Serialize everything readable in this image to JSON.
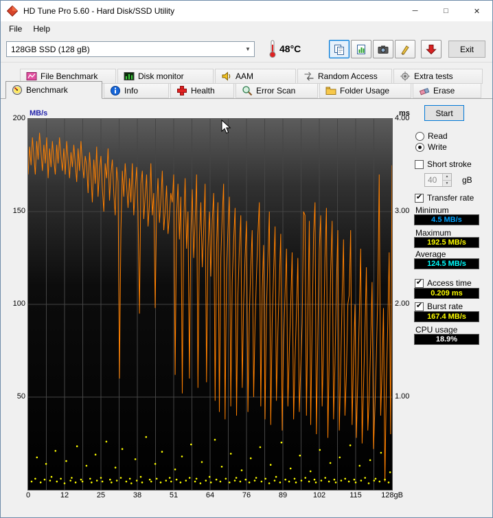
{
  "window": {
    "title": "HD Tune Pro 5.60 - Hard Disk/SSD Utility",
    "minimize_glyph": "─",
    "maximize_glyph": "□",
    "close_glyph": "✕"
  },
  "menu": {
    "file": "File",
    "help": "Help"
  },
  "toolbar": {
    "drive_select_value": "128GB SSD (128 gB)",
    "temperature": "48°C",
    "exit_label": "Exit"
  },
  "tabs": {
    "row1": [
      {
        "label": "File Benchmark"
      },
      {
        "label": "Disk monitor"
      },
      {
        "label": "AAM"
      },
      {
        "label": "Random Access"
      },
      {
        "label": "Extra tests"
      }
    ],
    "row2": [
      {
        "label": "Benchmark",
        "active": true
      },
      {
        "label": "Info"
      },
      {
        "label": "Health"
      },
      {
        "label": "Error Scan"
      },
      {
        "label": "Folder Usage"
      },
      {
        "label": "Erase"
      }
    ]
  },
  "panel": {
    "start_label": "Start",
    "read_label": "Read",
    "write_label": "Write",
    "read_selected": false,
    "write_selected": true,
    "short_stroke_label": "Short stroke",
    "short_stroke_checked": false,
    "short_stroke_value": "40",
    "short_stroke_unit": "gB",
    "transfer_rate_label": "Transfer rate",
    "transfer_rate_checked": true,
    "minimum_label": "Minimum",
    "minimum_value": "4.5 MB/s",
    "maximum_label": "Maximum",
    "maximum_value": "192.5 MB/s",
    "average_label": "Average",
    "average_value": "124.5 MB/s",
    "access_time_label": "Access time",
    "access_time_checked": true,
    "access_time_value": "0.209 ms",
    "burst_rate_label": "Burst rate",
    "burst_rate_checked": true,
    "burst_rate_value": "167.4 MB/s",
    "cpu_usage_label": "CPU usage",
    "cpu_usage_value": "18.9%",
    "value_colors": {
      "minimum": "#00a2ff",
      "maximum": "#ffff00",
      "average": "#00ffff",
      "access_time": "#ffff00",
      "burst_rate": "#ffff00",
      "cpu_usage": "#ffffff"
    }
  },
  "icons": {
    "app-icon": "red diamond",
    "chevron-down-icon": "▼",
    "thermometer-icon": "red thermometer",
    "copy-icon": "two pages",
    "report-icon": "pages with chart",
    "camera-icon": "camera",
    "brush-icon": "yellow brush",
    "download-icon": "red down arrow",
    "spinner-up": "▲",
    "spinner-down": "▼"
  },
  "chart_data": {
    "type": "line+scatter",
    "title": "HD Tune Pro write benchmark: transfer rate (MB/s) line and access time (ms) scatter vs disk position (gB)",
    "x_axis": {
      "min": 0,
      "max": 128,
      "ticks": [
        "0",
        "12",
        "25",
        "38",
        "51",
        "64",
        "76",
        "89",
        "102",
        "115",
        "128gB"
      ]
    },
    "y_left": {
      "label": "MB/s",
      "min": 0,
      "max": 200,
      "ticks": [
        {
          "label": "200",
          "value": 200
        },
        {
          "label": "150",
          "value": 150
        },
        {
          "label": "100",
          "value": 100
        },
        {
          "label": "50",
          "value": 50
        }
      ]
    },
    "y_right": {
      "label": "ms",
      "min": 0,
      "max": 4,
      "ticks": [
        {
          "label": "4.00",
          "value": 4
        },
        {
          "label": "3.00",
          "value": 3
        },
        {
          "label": "2.00",
          "value": 2
        },
        {
          "label": "1.00",
          "value": 1
        }
      ]
    },
    "grid": {
      "v_divisions": 20,
      "h_values": [
        50,
        100,
        150
      ]
    },
    "colors": {
      "transfer_rate": "#ff8000",
      "access_time": "#ffff00",
      "grid": "#454545",
      "plot_top": "#5c5c5c",
      "plot_bottom": "#000000"
    },
    "legend": "none",
    "transfer_rate_mbps": {
      "units": "MB/s",
      "values": [
        170,
        185,
        175,
        190,
        180,
        170,
        188,
        178,
        192.5,
        182,
        172,
        186,
        176,
        190,
        168,
        184,
        174,
        188,
        178,
        170,
        186,
        176,
        190,
        180,
        172,
        184,
        170,
        188,
        178,
        168,
        182,
        174,
        186,
        176,
        166,
        184,
        172,
        188,
        176,
        168,
        180,
        175,
        160,
        182,
        170,
        155,
        178,
        165,
        185,
        158,
        172,
        180,
        162,
        150,
        176,
        168,
        184,
        156,
        170,
        178,
        160,
        148,
        174,
        166,
        60,
        140,
        172,
        158,
        176,
        164,
        152,
        168,
        155,
        176,
        148,
        162,
        174,
        150,
        95,
        165,
        172,
        146,
        158,
        170,
        142,
        154,
        176,
        148,
        160,
        98,
        152,
        168,
        144,
        156,
        172,
        140,
        150,
        164,
        138,
        148,
        160,
        155,
        170,
        62,
        148,
        165,
        135,
        158,
        52,
        142,
        168,
        130,
        150,
        60,
        138,
        162,
        125,
        145,
        170,
        55,
        135,
        155,
        120,
        140,
        165,
        58,
        130,
        150,
        115,
        145,
        160,
        48,
        132,
        155,
        42,
        125,
        148,
        165,
        38,
        118,
        140,
        158,
        45,
        112,
        135,
        152,
        40,
        105,
        130,
        148,
        55,
        100,
        125,
        145,
        42,
        95,
        120,
        140,
        50,
        90,
        115,
        138,
        155,
        45,
        108,
        132,
        38,
        98,
        125,
        150,
        35,
        90,
        118,
        142,
        48,
        85,
        112,
        138,
        32,
        80,
        105,
        130,
        45,
        75,
        100,
        128,
        38,
        70,
        95,
        125,
        42,
        65,
        90,
        150,
        148,
        40,
        95,
        145,
        35,
        88,
        138,
        155,
        30,
        82,
        130,
        148,
        45,
        78,
        125,
        152,
        28,
        72,
        118,
        145,
        38,
        68,
        110,
        140,
        32,
        65,
        105,
        135,
        40,
        62,
        100,
        105,
        140,
        35,
        70,
        100,
        28,
        60,
        92,
        130,
        25,
        55,
        85,
        120,
        32,
        50,
        78,
        112,
        22,
        45,
        72,
        105,
        170,
        40,
        65,
        98,
        4.5,
        58,
        90,
        128,
        30,
        175
      ]
    },
    "access_time_points": [
      [
        1.2,
        0.09
      ],
      [
        2.5,
        0.12
      ],
      [
        3.1,
        0.35
      ],
      [
        4.4,
        0.08
      ],
      [
        5.8,
        0.11
      ],
      [
        6.3,
        0.28
      ],
      [
        7.7,
        0.1
      ],
      [
        8.2,
        0.14
      ],
      [
        9.6,
        0.42
      ],
      [
        10.1,
        0.09
      ],
      [
        11.5,
        0.12
      ],
      [
        12.8,
        0.07
      ],
      [
        13.4,
        0.31
      ],
      [
        14.9,
        0.1
      ],
      [
        15.3,
        0.13
      ],
      [
        16.7,
        0.08
      ],
      [
        17.2,
        0.47
      ],
      [
        18.6,
        0.11
      ],
      [
        19.1,
        0.09
      ],
      [
        20.5,
        0.26
      ],
      [
        21.8,
        0.12
      ],
      [
        22.3,
        0.08
      ],
      [
        23.7,
        0.38
      ],
      [
        24.2,
        0.1
      ],
      [
        25.6,
        0.13
      ],
      [
        26.1,
        0.09
      ],
      [
        27.5,
        0.52
      ],
      [
        28.8,
        0.11
      ],
      [
        29.3,
        0.08
      ],
      [
        30.7,
        0.24
      ],
      [
        31.2,
        0.1
      ],
      [
        32.6,
        0.13
      ],
      [
        33.1,
        0.44
      ],
      [
        34.5,
        0.09
      ],
      [
        35.8,
        0.12
      ],
      [
        36.3,
        0.07
      ],
      [
        37.7,
        0.33
      ],
      [
        38.2,
        0.1
      ],
      [
        39.6,
        0.14
      ],
      [
        40.1,
        0.08
      ],
      [
        41.5,
        0.57
      ],
      [
        42.8,
        0.11
      ],
      [
        43.3,
        0.09
      ],
      [
        44.7,
        0.28
      ],
      [
        45.2,
        0.12
      ],
      [
        46.6,
        0.08
      ],
      [
        47.1,
        0.41
      ],
      [
        48.5,
        0.1
      ],
      [
        49.8,
        0.13
      ],
      [
        50.3,
        0.09
      ],
      [
        51.7,
        0.22
      ],
      [
        52.2,
        0.11
      ],
      [
        53.6,
        0.08
      ],
      [
        54.1,
        0.36
      ],
      [
        55.5,
        0.1
      ],
      [
        56.8,
        0.13
      ],
      [
        57.3,
        0.49
      ],
      [
        58.7,
        0.09
      ],
      [
        59.2,
        0.12
      ],
      [
        60.6,
        0.07
      ],
      [
        61.1,
        0.3
      ],
      [
        62.5,
        0.1
      ],
      [
        63.8,
        0.14
      ],
      [
        64.3,
        0.08
      ],
      [
        65.7,
        0.54
      ],
      [
        66.2,
        0.11
      ],
      [
        67.6,
        0.09
      ],
      [
        68.1,
        0.25
      ],
      [
        69.5,
        0.12
      ],
      [
        70.8,
        0.08
      ],
      [
        71.3,
        0.39
      ],
      [
        72.7,
        0.1
      ],
      [
        73.2,
        0.13
      ],
      [
        74.6,
        0.09
      ],
      [
        75.1,
        0.21
      ],
      [
        76.5,
        0.11
      ],
      [
        77.8,
        0.08
      ],
      [
        78.3,
        0.34
      ],
      [
        79.7,
        0.1
      ],
      [
        80.2,
        0.13
      ],
      [
        81.6,
        0.46
      ],
      [
        82.1,
        0.09
      ],
      [
        83.5,
        0.12
      ],
      [
        84.8,
        0.07
      ],
      [
        85.3,
        0.27
      ],
      [
        86.7,
        0.1
      ],
      [
        87.2,
        0.14
      ],
      [
        88.6,
        0.08
      ],
      [
        89.1,
        0.51
      ],
      [
        90.5,
        0.11
      ],
      [
        91.8,
        0.09
      ],
      [
        92.3,
        0.23
      ],
      [
        93.7,
        0.12
      ],
      [
        94.2,
        0.08
      ],
      [
        95.6,
        0.37
      ],
      [
        96.1,
        0.1
      ],
      [
        97.5,
        0.13
      ],
      [
        98.8,
        0.09
      ],
      [
        99.3,
        0.2
      ],
      [
        100.7,
        0.11
      ],
      [
        101.2,
        0.08
      ],
      [
        102.6,
        0.43
      ],
      [
        103.1,
        0.1
      ],
      [
        104.5,
        0.13
      ],
      [
        105.8,
        0.09
      ],
      [
        106.3,
        0.29
      ],
      [
        107.7,
        0.11
      ],
      [
        108.2,
        0.08
      ],
      [
        109.6,
        0.35
      ],
      [
        110.1,
        0.1
      ],
      [
        111.5,
        0.12
      ],
      [
        112.8,
        0.09
      ],
      [
        113.3,
        0.48
      ],
      [
        114.7,
        0.11
      ],
      [
        115.2,
        0.08
      ],
      [
        116.6,
        0.26
      ],
      [
        117.1,
        0.1
      ],
      [
        118.5,
        0.13
      ],
      [
        119.8,
        0.07
      ],
      [
        120.3,
        0.32
      ],
      [
        121.7,
        0.1
      ],
      [
        122.2,
        0.12
      ],
      [
        123.6,
        0.09
      ],
      [
        124.1,
        0.4
      ],
      [
        125.5,
        0.11
      ],
      [
        126.8,
        0.08
      ],
      [
        127.3,
        0.19
      ]
    ]
  }
}
